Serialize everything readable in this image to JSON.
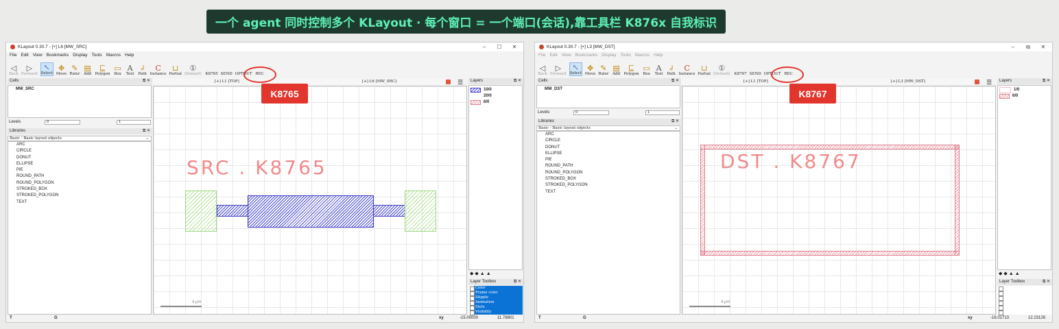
{
  "banner": {
    "text": "一个 agent 同时控制多个 KLayout · 每个窗口 = 一个端口(会话),靠工具栏 K876x 自我标识"
  },
  "menus": [
    "File",
    "Edit",
    "View",
    "Bookmarks",
    "Display",
    "Tools",
    "Macros",
    "Help"
  ],
  "tools": [
    {
      "label": "Back",
      "icon": "◁",
      "dim": true
    },
    {
      "label": "Forward",
      "icon": "▷",
      "dim": true
    },
    {
      "label": "Select",
      "icon": "↖",
      "sel": true
    },
    {
      "label": "Move",
      "icon": "✥"
    },
    {
      "label": "Ruler",
      "icon": "✎"
    },
    {
      "label": "Add",
      "icon": "▤"
    },
    {
      "label": "Polygon",
      "icon": "⊑"
    },
    {
      "label": "Box",
      "icon": "▭"
    },
    {
      "label": "Text",
      "icon": "A"
    },
    {
      "label": "Path",
      "icon": "↲"
    },
    {
      "label": "Instance",
      "icon": "C"
    },
    {
      "label": "Partial",
      "icon": "⊔"
    },
    {
      "label": "(Default)",
      "icon": "①",
      "dim": true
    }
  ],
  "windows": [
    {
      "title": "KLayout 0.30.7 - [+] L6 [MW_SRC]",
      "tool_extra": [
        "K8765",
        "SEND",
        "OPTOUT",
        "REC"
      ],
      "cells_label": "Cells",
      "cell_name": "MW_SRC",
      "levels_label": "Levels",
      "level_min": "0",
      "level_max": "1",
      "libraries_label": "Libraries",
      "library_select": "Basic - Basic layout objects",
      "library_items": [
        "ARC",
        "CIRCLE",
        "DONUT",
        "ELLIPSE",
        "PIE",
        "ROUND_PATH",
        "ROUND_POLYGON",
        "STROKED_BOX",
        "STROKED_POLYGON",
        "TEXT"
      ],
      "tab_left": "[+] L1 [TOP]",
      "tab_right": "[+] L6 [MW_SRC]",
      "layers_label": "Layers",
      "layers": [
        {
          "name": "10/0",
          "style": "blue"
        },
        {
          "name": "20/0",
          "style": "none"
        },
        {
          "name": "6/0",
          "style": "red"
        }
      ],
      "layer_toolbox_label": "Layer Toolbox",
      "toolbox_items": [
        "Color",
        "Frame color",
        "Stipple",
        "Animation",
        "Style",
        "Visibility"
      ],
      "canvas_text": "SRC . K8765",
      "scale_label": "4 µm",
      "badge": "K8765",
      "status_left": "T",
      "status_mid": "G",
      "status_xy": "xy",
      "coord_x": "-15.00000",
      "coord_y": "11.78801"
    },
    {
      "title": "KLayout 0.30.7 - [+] L3 [MW_DST]",
      "tool_extra": [
        "K8767",
        "SEND",
        "OPTOUT",
        "REC"
      ],
      "cells_label": "Cells",
      "cell_name": "MW_DST",
      "levels_label": "Levels",
      "level_min": "0",
      "level_max": "1",
      "libraries_label": "Libraries",
      "library_select": "Basic - Basic layout objects",
      "library_items": [
        "ARC",
        "CIRCLE",
        "DONUT",
        "ELLIPSE",
        "PIE",
        "ROUND_PATH",
        "ROUND_POLYGON",
        "STROKED_BOX",
        "STROKED_POLYGON",
        "TEXT"
      ],
      "tab_left": "[+] L1 [TOP]",
      "tab_right": "[+] L3 [MW_DST]",
      "layers_label": "Layers",
      "layers": [
        {
          "name": "1/0",
          "style": "none"
        },
        {
          "name": "6/0",
          "style": "red"
        }
      ],
      "layer_toolbox_label": "Layer Toolbox",
      "toolbox_items": [],
      "canvas_text": "DST . K8767",
      "scale_label": "4 µm",
      "badge": "K8767",
      "status_left": "T",
      "status_mid": "G",
      "status_xy": "xy",
      "coord_x": "-16.01713",
      "coord_y": "12.23126"
    }
  ],
  "colors": {
    "badge": "#e1352d",
    "banner_bg": "#1e3a2f",
    "banner_text": "#5ef0b4",
    "toolbox_sel": "#0b72d6"
  }
}
